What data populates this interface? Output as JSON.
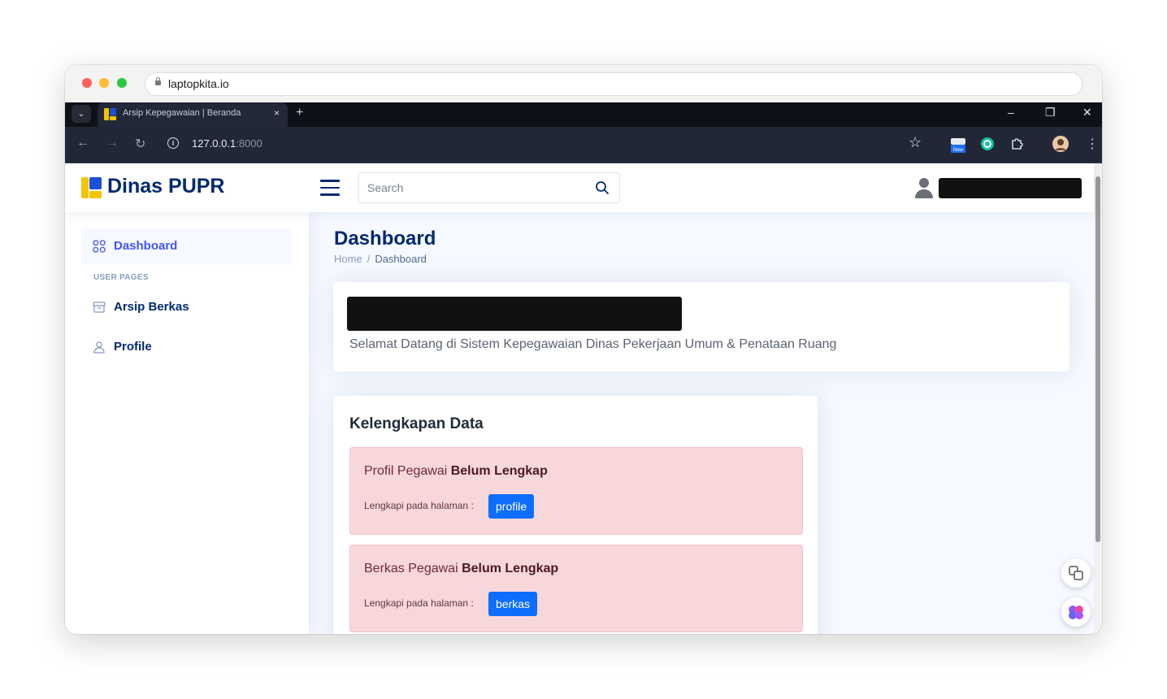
{
  "mac_window": {
    "url": "laptopkita.io"
  },
  "browser": {
    "tab_title": "Arsip Kepegawaian | Beranda",
    "url_host": "127.0.0.1",
    "url_port": ":8000",
    "close_tab": "×",
    "new_tab": "+",
    "tab_dropdown": "⌄",
    "window_min": "–",
    "window_restore": "❐",
    "window_close": "✕",
    "back": "←",
    "forward": "→",
    "reload": "↻",
    "info": "i",
    "star": "☆",
    "menu": "⋮"
  },
  "header": {
    "brand": "Dinas PUPR",
    "search_placeholder": "Search"
  },
  "sidebar": {
    "items": [
      {
        "label": "Dashboard",
        "icon": "grid-icon",
        "active": true
      },
      {
        "label": "Arsip Berkas",
        "icon": "archive-icon",
        "active": false
      },
      {
        "label": "Profile",
        "icon": "person-icon",
        "active": false
      }
    ],
    "heading": "USER PAGES"
  },
  "main": {
    "title": "Dashboard",
    "breadcrumb": [
      "Home",
      "/",
      "Dashboard"
    ],
    "welcome": "Selamat Datang di Sistem Kepegawaian Dinas Pekerjaan Umum & Penataan Ruang",
    "kelengkapan": {
      "title": "Kelengkapan Data",
      "alerts": [
        {
          "prefix": "Profil Pegawai ",
          "status": "Belum Lengkap",
          "hint": "Lengkapi pada halaman :",
          "button": "profile"
        },
        {
          "prefix": "Berkas Pegawai ",
          "status": "Belum Lengkap",
          "hint": "Lengkapi pada halaman :",
          "button": "berkas"
        }
      ]
    }
  },
  "colors": {
    "primary": "#4154f1",
    "navy": "#012970",
    "danger_bg": "#f8d7da",
    "button_blue": "#0d6efd",
    "browser_dark": "#222738"
  }
}
